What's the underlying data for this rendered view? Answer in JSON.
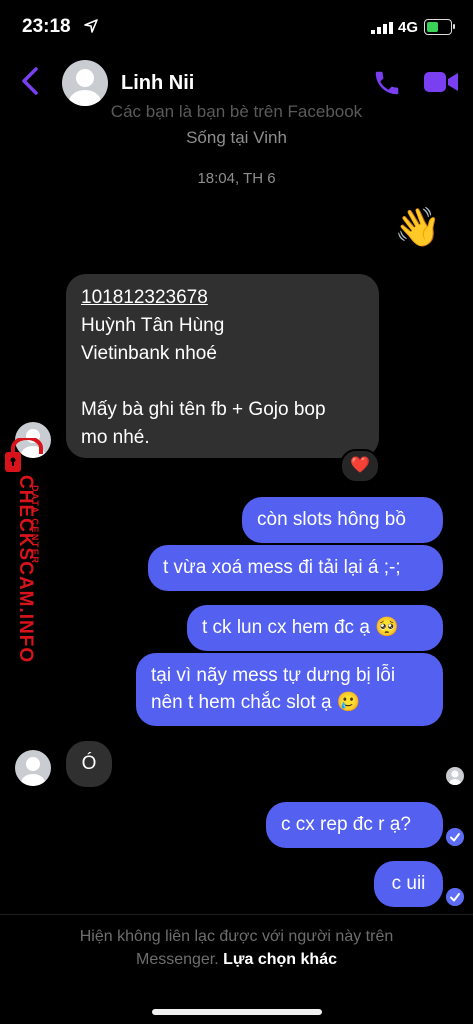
{
  "status_bar": {
    "time": "23:18",
    "network": "4G"
  },
  "header": {
    "contact_name": "Linh Nii"
  },
  "conversation_info": {
    "friends_line": "Các bạn là bạn bè trên Facebook",
    "lives_in": "Sống tại Vinh",
    "timestamp": "18:04, TH 6"
  },
  "messages": {
    "wave": "👋",
    "incoming_1": {
      "account_number": "101812323678",
      "name": "Huỳnh Tân Hùng",
      "bank": "Vietinbank nhoé",
      "note_line_1": "Mấy bà ghi tên fb + Gojo bop",
      "note_line_2": "mo nhé.",
      "reaction": "❤️"
    },
    "outgoing_1": "còn slots hông bồ",
    "outgoing_2": "t vừa xoá mess đi tải lại á ;-;",
    "outgoing_3": "t ck lun cx hem đc ạ 🥺",
    "outgoing_4_line_1": "tại vì nãy mess tự dưng bị lỗi",
    "outgoing_4_line_2": "nên t hem chắc slot ạ 🥲",
    "incoming_2": "Ó",
    "outgoing_5": "c cx rep đc r ạ?",
    "outgoing_6": "c uii"
  },
  "footer": {
    "line_1": "Hiện không liên lạc được với người này trên",
    "line_2_prefix": "Messenger.",
    "link": "Lựa chọn khác"
  },
  "watermark": {
    "main": "CHECKSCAM.INFO",
    "sub": "DATA CENTER"
  },
  "colors": {
    "accent": "#7b3ff2",
    "outgoing_bubble": "#5360f0",
    "incoming_bubble": "#303030",
    "watermark": "#d8131b"
  },
  "icons": [
    "location-arrow-icon",
    "signal-icon",
    "battery-icon",
    "back-icon",
    "phone-icon",
    "video-call-icon",
    "heart-icon",
    "check-icon"
  ]
}
